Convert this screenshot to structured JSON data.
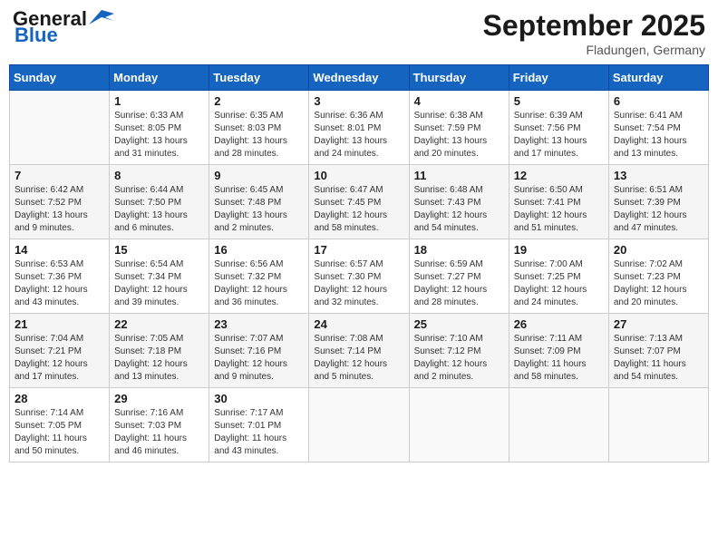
{
  "header": {
    "logo_general": "General",
    "logo_blue": "Blue",
    "month_title": "September 2025",
    "location": "Fladungen, Germany"
  },
  "days_of_week": [
    "Sunday",
    "Monday",
    "Tuesday",
    "Wednesday",
    "Thursday",
    "Friday",
    "Saturday"
  ],
  "weeks": [
    [
      {
        "day": "",
        "info": ""
      },
      {
        "day": "1",
        "info": "Sunrise: 6:33 AM\nSunset: 8:05 PM\nDaylight: 13 hours\nand 31 minutes."
      },
      {
        "day": "2",
        "info": "Sunrise: 6:35 AM\nSunset: 8:03 PM\nDaylight: 13 hours\nand 28 minutes."
      },
      {
        "day": "3",
        "info": "Sunrise: 6:36 AM\nSunset: 8:01 PM\nDaylight: 13 hours\nand 24 minutes."
      },
      {
        "day": "4",
        "info": "Sunrise: 6:38 AM\nSunset: 7:59 PM\nDaylight: 13 hours\nand 20 minutes."
      },
      {
        "day": "5",
        "info": "Sunrise: 6:39 AM\nSunset: 7:56 PM\nDaylight: 13 hours\nand 17 minutes."
      },
      {
        "day": "6",
        "info": "Sunrise: 6:41 AM\nSunset: 7:54 PM\nDaylight: 13 hours\nand 13 minutes."
      }
    ],
    [
      {
        "day": "7",
        "info": "Sunrise: 6:42 AM\nSunset: 7:52 PM\nDaylight: 13 hours\nand 9 minutes."
      },
      {
        "day": "8",
        "info": "Sunrise: 6:44 AM\nSunset: 7:50 PM\nDaylight: 13 hours\nand 6 minutes."
      },
      {
        "day": "9",
        "info": "Sunrise: 6:45 AM\nSunset: 7:48 PM\nDaylight: 13 hours\nand 2 minutes."
      },
      {
        "day": "10",
        "info": "Sunrise: 6:47 AM\nSunset: 7:45 PM\nDaylight: 12 hours\nand 58 minutes."
      },
      {
        "day": "11",
        "info": "Sunrise: 6:48 AM\nSunset: 7:43 PM\nDaylight: 12 hours\nand 54 minutes."
      },
      {
        "day": "12",
        "info": "Sunrise: 6:50 AM\nSunset: 7:41 PM\nDaylight: 12 hours\nand 51 minutes."
      },
      {
        "day": "13",
        "info": "Sunrise: 6:51 AM\nSunset: 7:39 PM\nDaylight: 12 hours\nand 47 minutes."
      }
    ],
    [
      {
        "day": "14",
        "info": "Sunrise: 6:53 AM\nSunset: 7:36 PM\nDaylight: 12 hours\nand 43 minutes."
      },
      {
        "day": "15",
        "info": "Sunrise: 6:54 AM\nSunset: 7:34 PM\nDaylight: 12 hours\nand 39 minutes."
      },
      {
        "day": "16",
        "info": "Sunrise: 6:56 AM\nSunset: 7:32 PM\nDaylight: 12 hours\nand 36 minutes."
      },
      {
        "day": "17",
        "info": "Sunrise: 6:57 AM\nSunset: 7:30 PM\nDaylight: 12 hours\nand 32 minutes."
      },
      {
        "day": "18",
        "info": "Sunrise: 6:59 AM\nSunset: 7:27 PM\nDaylight: 12 hours\nand 28 minutes."
      },
      {
        "day": "19",
        "info": "Sunrise: 7:00 AM\nSunset: 7:25 PM\nDaylight: 12 hours\nand 24 minutes."
      },
      {
        "day": "20",
        "info": "Sunrise: 7:02 AM\nSunset: 7:23 PM\nDaylight: 12 hours\nand 20 minutes."
      }
    ],
    [
      {
        "day": "21",
        "info": "Sunrise: 7:04 AM\nSunset: 7:21 PM\nDaylight: 12 hours\nand 17 minutes."
      },
      {
        "day": "22",
        "info": "Sunrise: 7:05 AM\nSunset: 7:18 PM\nDaylight: 12 hours\nand 13 minutes."
      },
      {
        "day": "23",
        "info": "Sunrise: 7:07 AM\nSunset: 7:16 PM\nDaylight: 12 hours\nand 9 minutes."
      },
      {
        "day": "24",
        "info": "Sunrise: 7:08 AM\nSunset: 7:14 PM\nDaylight: 12 hours\nand 5 minutes."
      },
      {
        "day": "25",
        "info": "Sunrise: 7:10 AM\nSunset: 7:12 PM\nDaylight: 12 hours\nand 2 minutes."
      },
      {
        "day": "26",
        "info": "Sunrise: 7:11 AM\nSunset: 7:09 PM\nDaylight: 11 hours\nand 58 minutes."
      },
      {
        "day": "27",
        "info": "Sunrise: 7:13 AM\nSunset: 7:07 PM\nDaylight: 11 hours\nand 54 minutes."
      }
    ],
    [
      {
        "day": "28",
        "info": "Sunrise: 7:14 AM\nSunset: 7:05 PM\nDaylight: 11 hours\nand 50 minutes."
      },
      {
        "day": "29",
        "info": "Sunrise: 7:16 AM\nSunset: 7:03 PM\nDaylight: 11 hours\nand 46 minutes."
      },
      {
        "day": "30",
        "info": "Sunrise: 7:17 AM\nSunset: 7:01 PM\nDaylight: 11 hours\nand 43 minutes."
      },
      {
        "day": "",
        "info": ""
      },
      {
        "day": "",
        "info": ""
      },
      {
        "day": "",
        "info": ""
      },
      {
        "day": "",
        "info": ""
      }
    ]
  ]
}
